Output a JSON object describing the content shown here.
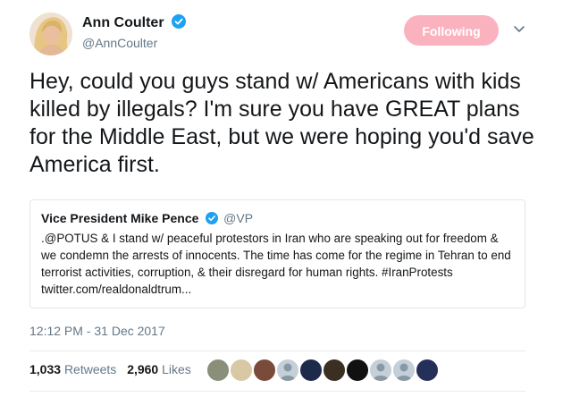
{
  "author": {
    "display_name": "Ann Coulter",
    "handle": "@AnnCoulter",
    "verified": true
  },
  "follow_button": {
    "label": "Following",
    "color": "#fbb2bf"
  },
  "tweet": {
    "text": "Hey, could you guys stand w/ Americans with kids killed by illegals?  I'm sure you have GREAT plans for the Middle East, but we were hoping you'd save America first."
  },
  "quoted_tweet": {
    "display_name": "Vice President Mike Pence",
    "handle": "@VP",
    "verified": true,
    "text": ".@POTUS & I stand w/ peaceful protestors in Iran who are speaking out for freedom & we condemn the arrests of innocents. The time has come for the regime in Tehran to end terrorist activities, corruption, & their disregard for human rights. #IranProtests twitter.com/realdonaldtrum..."
  },
  "timestamp": "12:12 PM - 31 Dec 2017",
  "stats": {
    "retweets_count": "1,033",
    "retweets_label": "Retweets",
    "likes_count": "2,960",
    "likes_label": "Likes"
  },
  "likers": [
    {
      "color": "#8a8f7a"
    },
    {
      "color": "#d9c8a4"
    },
    {
      "color": "#7a4a3a"
    },
    {
      "color": "#c4cfd8"
    },
    {
      "color": "#1d2a4a"
    },
    {
      "color": "#3b2e22"
    },
    {
      "color": "#111111"
    },
    {
      "color": "#c4cfd8"
    },
    {
      "color": "#c4cfd8"
    },
    {
      "color": "#25305a"
    }
  ],
  "colors": {
    "verified_badge": "#1da1f2",
    "text_primary": "#14171a",
    "text_secondary": "#657786"
  }
}
